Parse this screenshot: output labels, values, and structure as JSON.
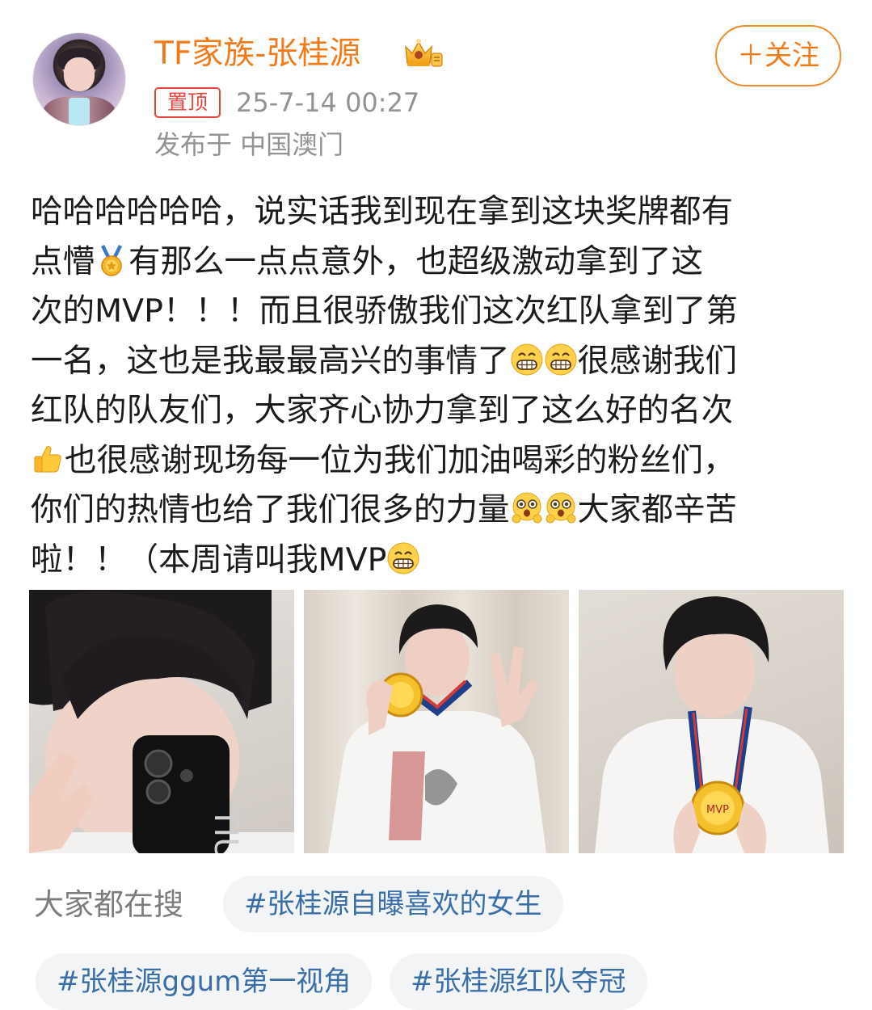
{
  "author": {
    "name": "TF家族-张桂源",
    "name_color": "#f07b1a",
    "badge_icon": "crown-icon"
  },
  "follow_button": {
    "label": "＋关注"
  },
  "meta": {
    "pinned_label": "置顶",
    "timestamp": "25-7-14 00:27",
    "location": "发布于 中国澳门"
  },
  "post": {
    "lines": [
      "哈哈哈哈哈哈，说实话我到现在拿到这块奖牌都有",
      [
        "点懵",
        {
          "emoji": "medal-emoji"
        },
        "有那么一点点意外，也超级激动拿到了这"
      ],
      "次的MVP！！！而且很骄傲我们这次红队拿到了第",
      [
        "一名，这也是我最最高兴的事情了",
        {
          "emoji": "grin-emoji"
        },
        {
          "emoji": "grin-emoji"
        },
        "很感谢我们"
      ],
      "红队的队友们，大家齐心协力拿到了这么好的名次",
      [
        {
          "emoji": "thumbs-up-emoji"
        },
        "也很感谢现场每一位为我们加油喝彩的粉丝们，"
      ],
      [
        "你们的热情也给了我们很多的力量",
        {
          "emoji": "starry-eyes-emoji"
        },
        {
          "emoji": "starry-eyes-emoji"
        },
        "大家都辛苦"
      ],
      [
        "啦！！（本周请叫我MVP",
        {
          "emoji": "grin-emoji"
        }
      ]
    ],
    "images": [
      {
        "name": "photo-mirror-selfie"
      },
      {
        "name": "photo-medal-peace-sign"
      },
      {
        "name": "photo-medal-holding"
      }
    ]
  },
  "hot_search": {
    "label": "大家都在搜",
    "tags": [
      "#张桂源自曝喜欢的女生",
      "#张桂源ggum第一视角",
      "#张桂源红队夺冠"
    ],
    "tag_color": "#3a6ea8"
  }
}
